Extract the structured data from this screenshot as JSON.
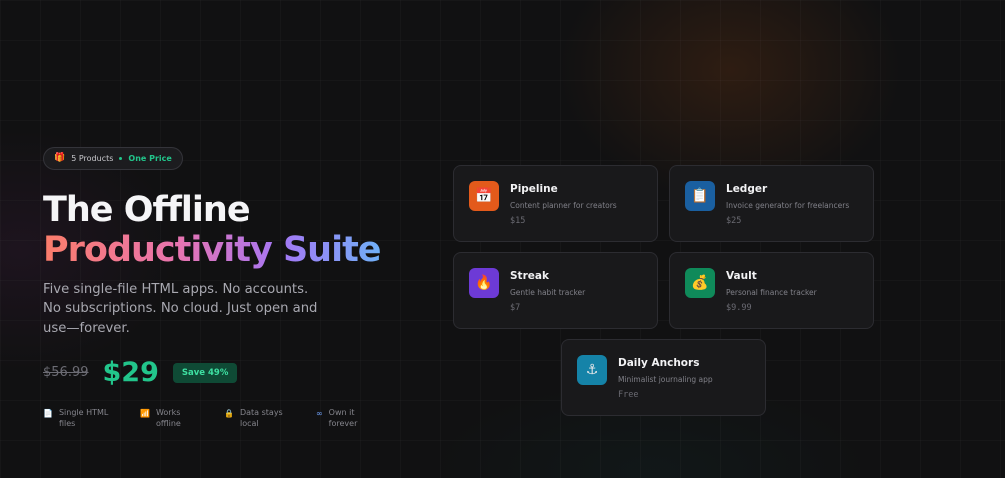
{
  "badge": {
    "icon": "gift-icon",
    "products": "5 Products",
    "separator_color": "#22c58b",
    "price_label": "One Price"
  },
  "hero": {
    "title_line1": "The Offline",
    "title_line2": "Productivity Suite",
    "subtitle": "Five single-file HTML apps. No accounts. No subscriptions. No cloud. Just open and use—forever."
  },
  "pricing": {
    "old_price": "$56.99",
    "new_price": "$29",
    "save_label": "Save 49%",
    "accent": "#22c58b"
  },
  "features": [
    {
      "icon": "document-icon",
      "glyph": "📄",
      "label": "Single HTML files"
    },
    {
      "icon": "offline-icon",
      "glyph": "📶",
      "label": "Works offline"
    },
    {
      "icon": "lock-icon",
      "glyph": "🔒",
      "label": "Data stays local"
    },
    {
      "icon": "infinity-icon",
      "glyph": "∞",
      "label": "Own it forever"
    }
  ],
  "products": [
    {
      "icon": "calendar-icon",
      "glyph": "📅",
      "color": "#e35a1b",
      "name": "Pipeline",
      "desc": "Content planner for creators",
      "price": "$15"
    },
    {
      "icon": "clipboard-icon",
      "glyph": "📋",
      "color": "#1a5fa0",
      "name": "Ledger",
      "desc": "Invoice generator for freelancers",
      "price": "$25"
    },
    {
      "icon": "flame-icon",
      "glyph": "🔥",
      "color": "#6d3ad6",
      "name": "Streak",
      "desc": "Gentle habit tracker",
      "price": "$7"
    },
    {
      "icon": "money-bag-icon",
      "glyph": "💰",
      "color": "#0f8a5a",
      "name": "Vault",
      "desc": "Personal finance tracker",
      "price": "$9.99"
    },
    {
      "icon": "anchor-icon",
      "glyph": "⚓",
      "color": "#1583a8",
      "name": "Daily Anchors",
      "desc": "Minimalist journaling app",
      "price": "Free"
    }
  ]
}
